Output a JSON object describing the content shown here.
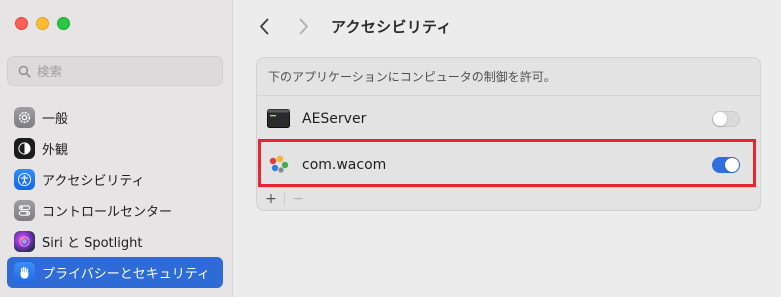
{
  "window": {
    "title": "アクセシビリティ"
  },
  "search": {
    "placeholder": "検索"
  },
  "sidebar": {
    "items": [
      {
        "label": "一般",
        "icon": "gear-icon"
      },
      {
        "label": "外観",
        "icon": "appearance-icon"
      },
      {
        "label": "アクセシビリティ",
        "icon": "accessibility-icon"
      },
      {
        "label": "コントロールセンター",
        "icon": "toggles-icon"
      },
      {
        "label": "Siri と Spotlight",
        "icon": "siri-icon"
      },
      {
        "label": "プライバシーとセキュリティ",
        "icon": "hand-icon",
        "active": true
      }
    ]
  },
  "panel": {
    "description": "下のアプリケーションにコンピュータの制御を許可。",
    "apps": [
      {
        "name": "AEServer",
        "enabled": false,
        "icon": "terminal-icon"
      },
      {
        "name": "com.wacom",
        "enabled": true,
        "icon": "wacom-icon"
      }
    ],
    "add_label": "+",
    "remove_label": "−"
  },
  "colors": {
    "accent": "#2e6bd7",
    "highlight": "#e5252f"
  }
}
